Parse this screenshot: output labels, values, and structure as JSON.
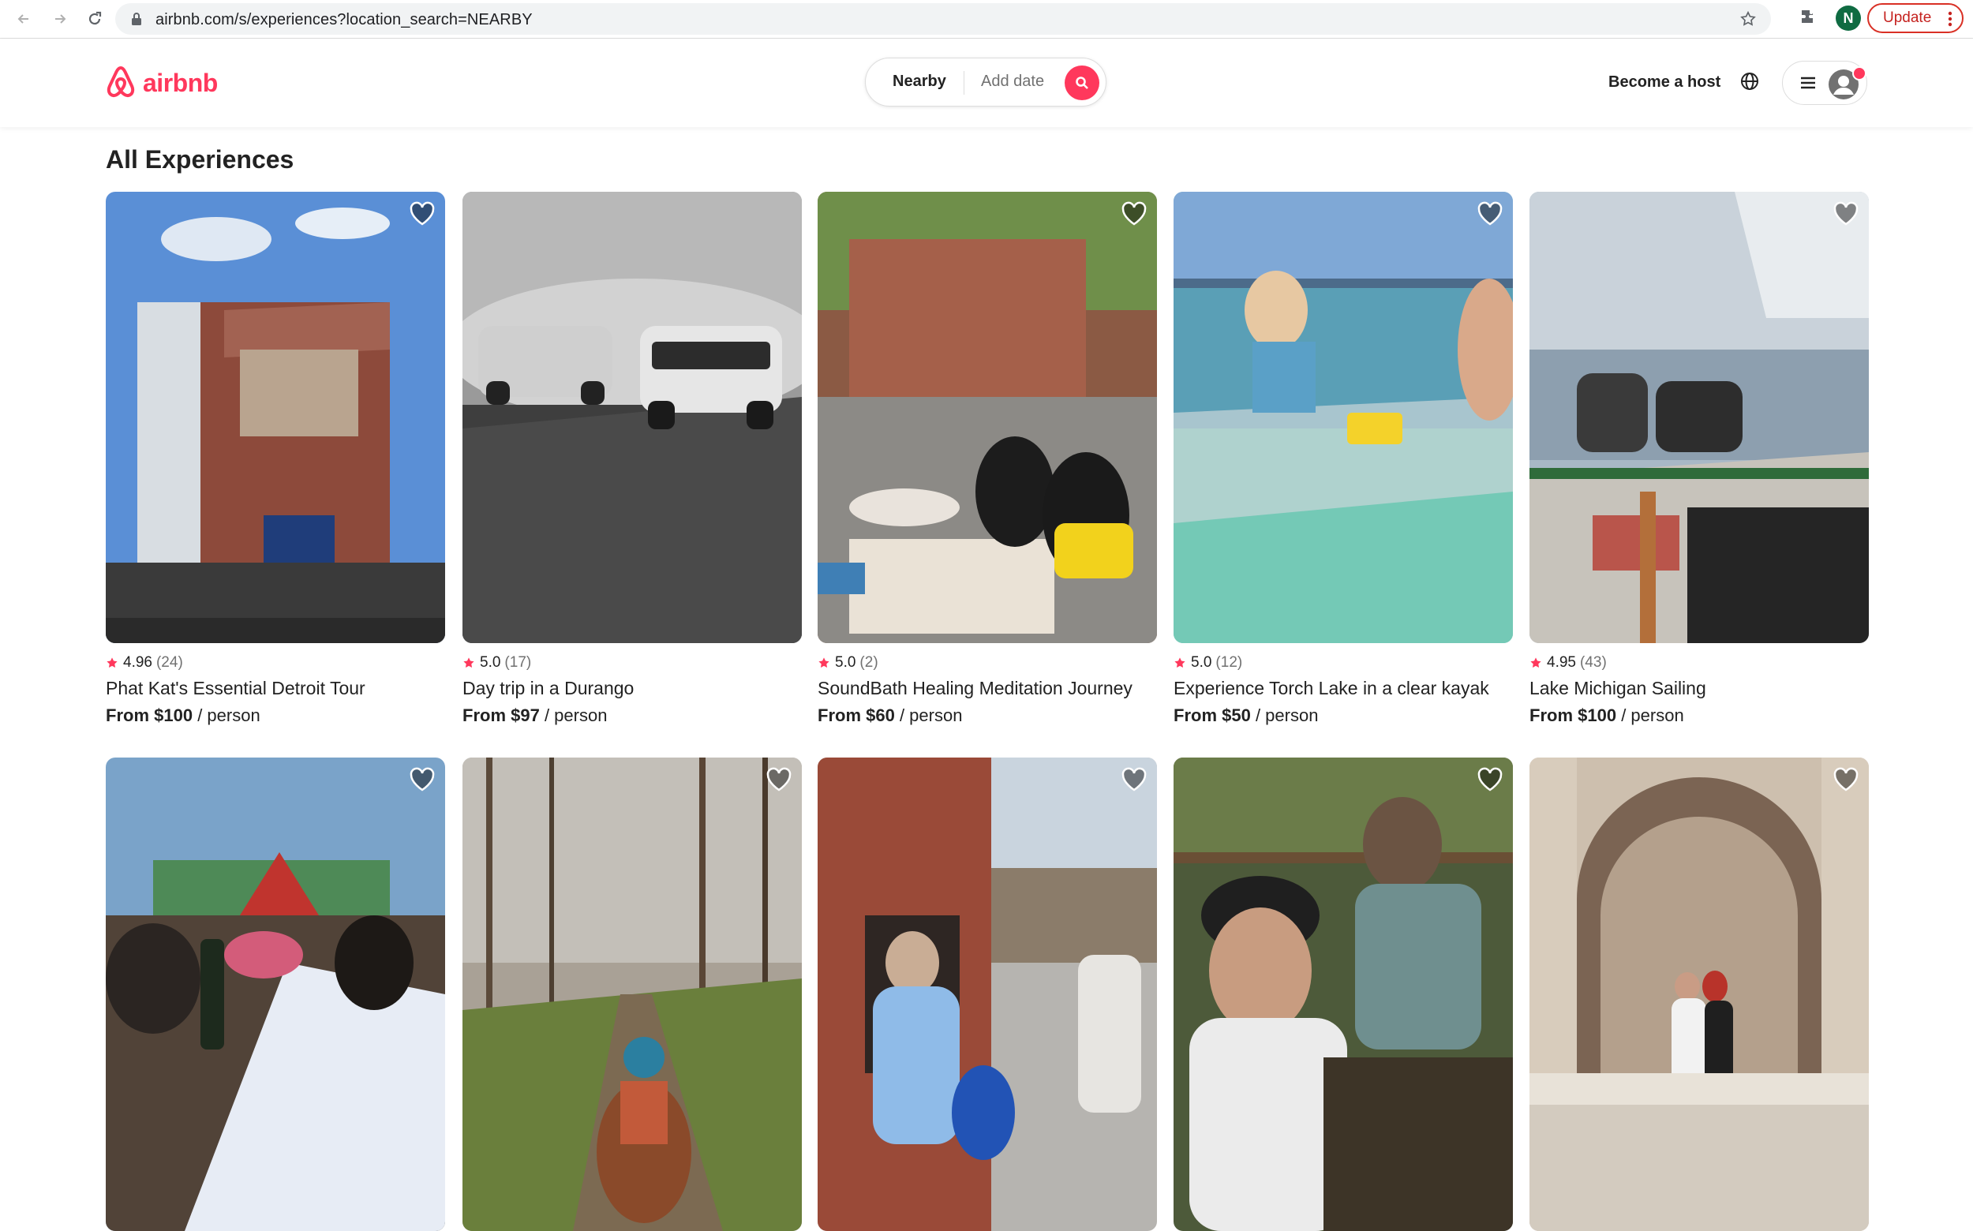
{
  "browser": {
    "url": "airbnb.com/s/experiences?location_search=NEARBY",
    "profile_initial": "N",
    "update_label": "Update"
  },
  "header": {
    "brand": "airbnb",
    "search": {
      "location": "Nearby",
      "date_placeholder": "Add date"
    },
    "become_host": "Become a host"
  },
  "page_title": "All Experiences",
  "experiences": [
    {
      "rating": "4.96",
      "reviews": "(24)",
      "title": "Phat Kat's Essential Detroit Tour",
      "price": "From $100",
      "unit": "/ person"
    },
    {
      "rating": "5.0",
      "reviews": "(17)",
      "title": "Day trip in a Durango",
      "price": "From $97",
      "unit": "/ person"
    },
    {
      "rating": "5.0",
      "reviews": "(2)",
      "title": "SoundBath Healing Meditation Journey",
      "price": "From $60",
      "unit": "/ person"
    },
    {
      "rating": "5.0",
      "reviews": "(12)",
      "title": "Experience Torch Lake in a clear kayak",
      "price": "From $50",
      "unit": "/ person"
    },
    {
      "rating": "4.95",
      "reviews": "(43)",
      "title": "Lake Michigan Sailing",
      "price": "From $100",
      "unit": "/ person"
    }
  ],
  "colors": {
    "brand": "#ff385c",
    "text": "#222222",
    "muted": "#717171"
  }
}
